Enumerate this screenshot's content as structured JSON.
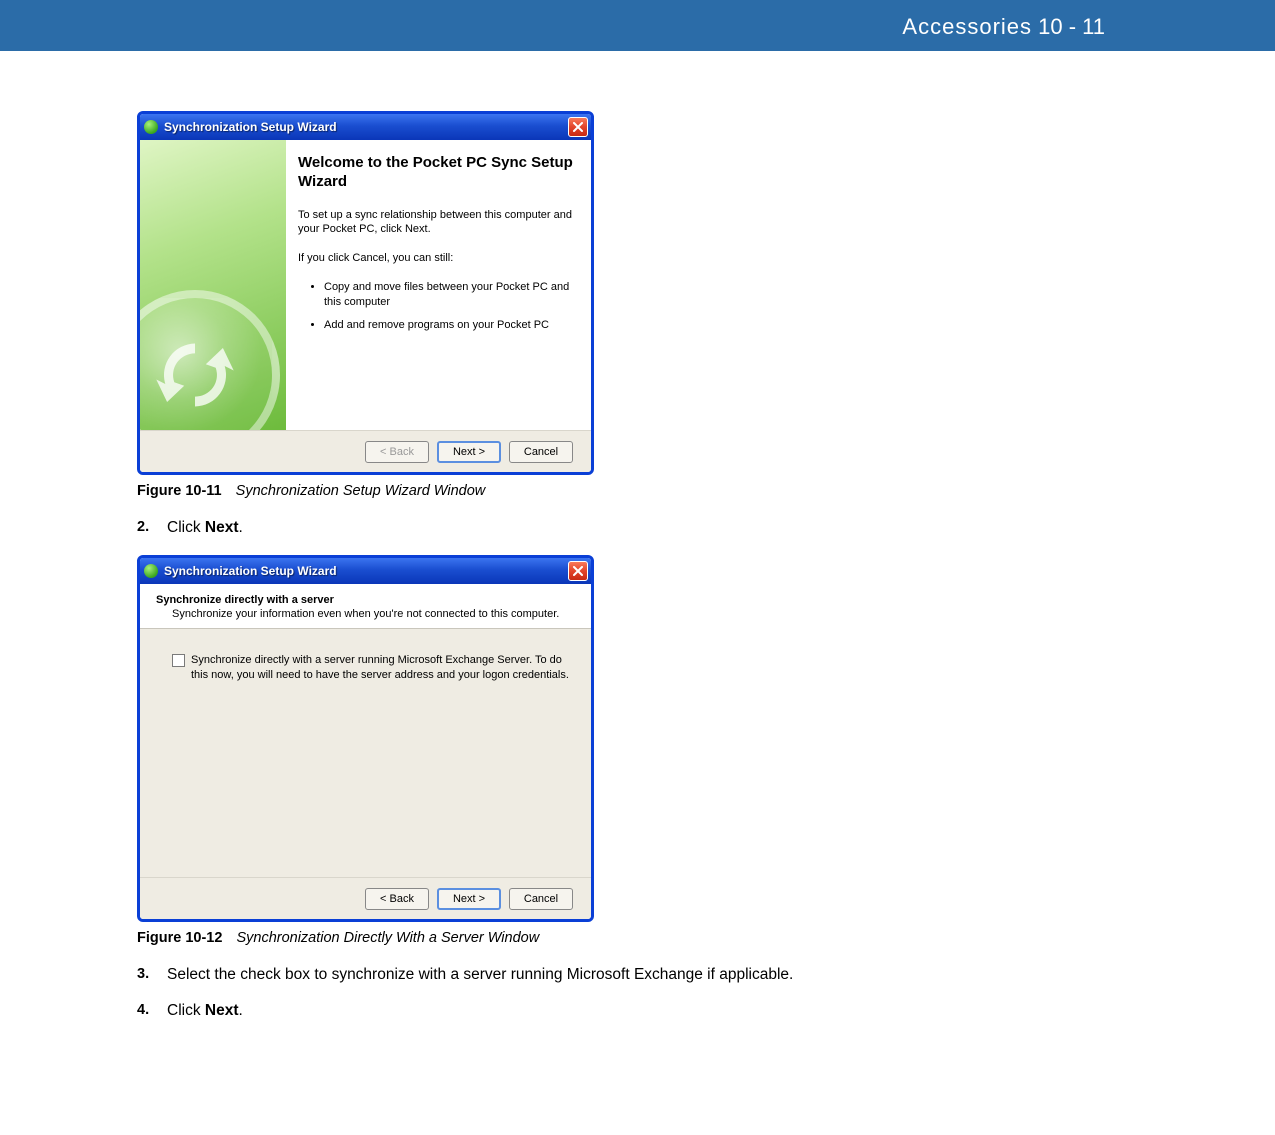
{
  "header": {
    "section": "Accessories",
    "page": "10 - 11"
  },
  "dialog1": {
    "title": "Synchronization Setup Wizard",
    "h2": "Welcome to the Pocket PC Sync Setup Wizard",
    "p1": "To set up a sync relationship between this computer and your Pocket PC, click Next.",
    "p2": "If you click Cancel, you can still:",
    "li1": "Copy and move files between your Pocket PC and this computer",
    "li2": "Add and remove programs on your Pocket PC",
    "back": "< Back",
    "next": "Next >",
    "cancel": "Cancel"
  },
  "figure1": {
    "num": "Figure 10-11",
    "title": "Synchronization Setup Wizard Window"
  },
  "step2": {
    "num": "2.",
    "pre": "Click ",
    "bold": "Next",
    "post": "."
  },
  "dialog2": {
    "title": "Synchronization Setup Wizard",
    "heading": "Synchronize directly with a server",
    "sub": "Synchronize your information even when you're not connected to this computer.",
    "checklabel": "Synchronize directly with a server running Microsoft Exchange Server.  To do this now, you will need to have the server address and your logon credentials.",
    "back": "< Back",
    "next": "Next >",
    "cancel": "Cancel"
  },
  "figure2": {
    "num": "Figure 10-12",
    "title": "Synchronization Directly With a Server Window"
  },
  "step3": {
    "num": "3.",
    "text": "Select the check box to synchronize with a server running Microsoft Exchange if applicable."
  },
  "step4": {
    "num": "4.",
    "pre": "Click ",
    "bold": "Next",
    "post": "."
  }
}
